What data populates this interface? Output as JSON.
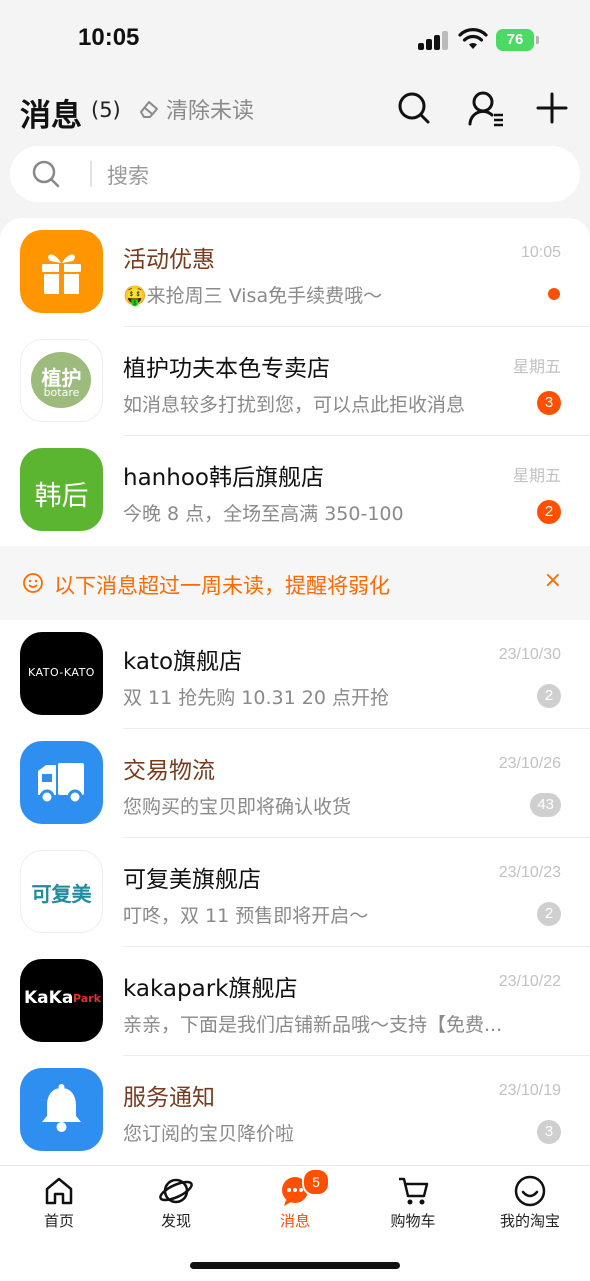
{
  "status_bar": {
    "time": "10:05",
    "battery": "76"
  },
  "header": {
    "title": "消息",
    "count": "(5)",
    "clear_label": "清除未读"
  },
  "search": {
    "placeholder": "搜索"
  },
  "conversations": [
    {
      "name": "活动优惠",
      "time": "10:05",
      "preview": "🤑来抢周三 Visa免手续费哦～",
      "unread": "",
      "name_color": "orange",
      "avatar_icon": "gift-icon",
      "avatar_bg": "#ff9500"
    },
    {
      "name": "植护功夫本色专卖店",
      "time": "星期五",
      "preview": "如消息较多打扰到您，可以点此拒收消息",
      "unread": "3",
      "avatar_text": "植护",
      "avatar_subtext": "botare",
      "avatar_bg": "#ffffff"
    },
    {
      "name": "hanhoo韩后旗舰店",
      "time": "星期五",
      "preview": "今晚 8 点，全场至高满 350-100",
      "unread": "2",
      "avatar_text": "韩后",
      "avatar_bg": "#5cb531"
    }
  ],
  "notice": {
    "text": "以下消息超过一周未读，提醒将弱化",
    "close": "×"
  },
  "older_conversations": [
    {
      "name": "kato旗舰店",
      "time": "23/10/30",
      "preview": "双 11 抢先购 10.31 20 点开抢",
      "unread": "2",
      "avatar_text": "KATO-KATO",
      "avatar_bg": "#000000"
    },
    {
      "name": "交易物流",
      "time": "23/10/26",
      "preview": "您购买的宝贝即将确认收货",
      "unread": "43",
      "name_color": "orange",
      "avatar_icon": "truck-icon",
      "avatar_bg": "#2f8ff0"
    },
    {
      "name": "可复美旗舰店",
      "time": "23/10/23",
      "preview": "叮咚，双 11 预售即将开启～",
      "unread": "2",
      "avatar_text": "可复美",
      "avatar_bg": "#ffffff"
    },
    {
      "name": "kakapark旗舰店",
      "time": "23/10/22",
      "preview": "亲亲，下面是我们店铺新品哦～支持【免费...",
      "unread": "",
      "avatar_text": "KaKa",
      "avatar_subtext": "Park",
      "avatar_bg": "#000000"
    },
    {
      "name": "服务通知",
      "time": "23/10/19",
      "preview": "您订阅的宝贝降价啦",
      "unread": "3",
      "name_color": "orange",
      "avatar_icon": "bell-icon",
      "avatar_bg": "#2f8ff0"
    }
  ],
  "tabbar": {
    "items": [
      {
        "label": "首页",
        "icon": "home-icon"
      },
      {
        "label": "发现",
        "icon": "planet-icon"
      },
      {
        "label": "消息",
        "icon": "chat-icon",
        "badge": "5",
        "active": true
      },
      {
        "label": "购物车",
        "icon": "cart-icon"
      },
      {
        "label": "我的淘宝",
        "icon": "smile-icon"
      }
    ]
  },
  "colors": {
    "accent": "#ff5000",
    "notice": "#ff6a00",
    "orange_name": "#7a3a1c"
  }
}
